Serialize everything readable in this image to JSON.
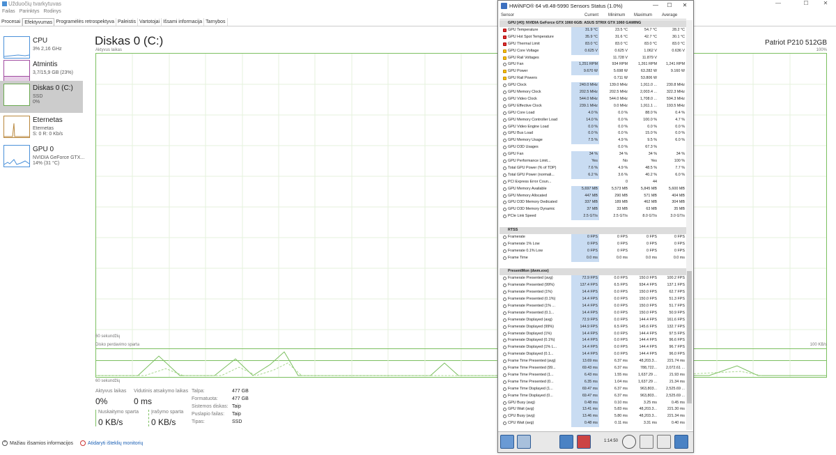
{
  "taskmanager": {
    "title": "Užduočių tvarkytuvas",
    "menu": [
      "Failas",
      "Parinktys",
      "Rodinys"
    ],
    "tabs": [
      "Procesai",
      "Efektyvumas",
      "Programėlės retrospektyva",
      "Paleistis",
      "Vartotojai",
      "Išsami informacija",
      "Tarnybos"
    ],
    "sidebar": [
      {
        "name": "CPU",
        "sub1": "3% 2,16 GHz",
        "sub2": ""
      },
      {
        "name": "Atmintis",
        "sub1": "3,7/15,9 GB (23%)",
        "sub2": ""
      },
      {
        "name": "Diskas 0 (C:)",
        "sub1": "SSD",
        "sub2": "0%"
      },
      {
        "name": "Eternetas",
        "sub1": "Eternetas",
        "sub2": "S: 0 R: 0 Kb/s"
      },
      {
        "name": "GPU 0",
        "sub1": "NVIDIA GeForce GTX...",
        "sub2": "14% (31 °C)"
      }
    ],
    "main": {
      "title": "Diskas 0 (C:)",
      "device": "Patriot P210 512GB",
      "active_label": "Aktyvus laikas",
      "active_max": "100%",
      "seconds_label": "60 sekundžių",
      "speed_label": "Disko perdavimo sparta",
      "speed_max": "100 KB/s",
      "seconds_label2": "60 sekundžių"
    },
    "stats": {
      "active_time_label": "Aktyvus laikas",
      "active_time": "0%",
      "avg_response_label": "Vidutinis atsakymo laikas",
      "avg_response": "0 ms",
      "read_label": "Nuskaitymo sparta",
      "read": "0 KB/s",
      "write_label": "Įrašymo sparta",
      "write": "0 KB/s",
      "info": [
        {
          "label": "Talpa:",
          "value": "477 GB"
        },
        {
          "label": "Formatuota:",
          "value": "477 GB"
        },
        {
          "label": "Sistemos diskas:",
          "value": "Taip"
        },
        {
          "label": "Puslapio failas:",
          "value": "Taip"
        },
        {
          "label": "Tipas:",
          "value": "SSD"
        }
      ]
    },
    "footer": {
      "less_details": "Mažiau išsamios informacijos",
      "open_monitor": "Atidaryti išteklių monitorių"
    }
  },
  "hwinfo": {
    "title": "HWiNFO® 64 v8.48-5990 Sensors Status (1.0%)",
    "columns": {
      "sensor": "Sensor",
      "current": "Current",
      "min": "Minimum",
      "max": "Maximum",
      "avg": "Average"
    },
    "time": "1:14:50",
    "rows": [
      {
        "type": "group",
        "name": "GPU [#0]: NVIDIA GeForce GTX 1060 6GB: ASUS STRIX GTX 1060 GAMING"
      },
      {
        "icon": "red",
        "name": "GPU Temperature",
        "cur": "31.9 °C",
        "min": "23.5 °C",
        "max": "54.7 °C",
        "avg": "28.2 °C"
      },
      {
        "icon": "red",
        "name": "GPU Hot Spot Temperature",
        "cur": "35.9 °C",
        "min": "31.6 °C",
        "max": "42.7 °C",
        "avg": "30.1 °C"
      },
      {
        "icon": "red",
        "name": "GPU Thermal Limit",
        "cur": "83.0 °C",
        "min": "83.0 °C",
        "max": "83.0 °C",
        "avg": "83.0 °C"
      },
      {
        "icon": "yel",
        "name": "GPU Core Voltage",
        "cur": "0.625 V",
        "min": "0.625 V",
        "max": "1.062 V",
        "avg": "0.636 V"
      },
      {
        "icon": "yel",
        "name": "GPU Rail Voltages",
        "cur": "",
        "min": "11.728 V",
        "max": "11.879 V",
        "avg": ""
      },
      {
        "icon": "fan",
        "name": "GPU Fan",
        "cur": "1,251 RPM",
        "min": "934 RPM",
        "max": "1,261 RPM",
        "avg": "1,241 RPM"
      },
      {
        "icon": "yel",
        "name": "GPU Power",
        "cur": "9.670 W",
        "min": "5.698 W",
        "max": "63.282 W",
        "avg": "9.160 W"
      },
      {
        "icon": "yel",
        "name": "GPU Rail Powers",
        "cur": "",
        "min": "0.711 W",
        "max": "53.806 W",
        "avg": ""
      },
      {
        "icon": "clk",
        "name": "GPU Clock",
        "cur": "240.0 MHz",
        "min": "139.0 MHz",
        "max": "1,911.0 ...",
        "avg": "230.8 MHz"
      },
      {
        "icon": "clk",
        "name": "GPU Memory Clock",
        "cur": "202.5 MHz",
        "min": "202.5 MHz",
        "max": "2,003.4 ...",
        "avg": "322.3 MHz"
      },
      {
        "icon": "clk",
        "name": "GPU Video Clock",
        "cur": "544.0 MHz",
        "min": "544.0 MHz",
        "max": "1,708.0 ...",
        "avg": "594.3 MHz"
      },
      {
        "icon": "clk",
        "name": "GPU Effective Clock",
        "cur": "239.1 MHz",
        "min": "0.0 MHz",
        "max": "1,911.1 ...",
        "avg": "193.5 MHz"
      },
      {
        "icon": "clk",
        "name": "GPU Core Load",
        "cur": "4.0 %",
        "min": "0.0 %",
        "max": "88.0 %",
        "avg": "0.4 %"
      },
      {
        "icon": "clk",
        "name": "GPU Memory Controller Load",
        "cur": "14.0 %",
        "min": "0.0 %",
        "max": "100.0 %",
        "avg": "4.7 %"
      },
      {
        "icon": "clk",
        "name": "GPU Video Engine Load",
        "cur": "0.0 %",
        "min": "0.0 %",
        "max": "0.0 %",
        "avg": "0.0 %"
      },
      {
        "icon": "clk",
        "name": "GPU Bus Load",
        "cur": "0.0 %",
        "min": "0.0 %",
        "max": "15.0 %",
        "avg": "0.0 %"
      },
      {
        "icon": "clk",
        "name": "GPU Memory Usage",
        "cur": "7.5 %",
        "min": "4.9 %",
        "max": "9.5 %",
        "avg": "6.0 %"
      },
      {
        "icon": "clk",
        "name": "GPU D3D Usages",
        "cur": "",
        "min": "0.0 %",
        "max": "67.3 %",
        "avg": ""
      },
      {
        "icon": "clk",
        "name": "GPU Fan",
        "cur": "34 %",
        "min": "34 %",
        "max": "34 %",
        "avg": "34 %"
      },
      {
        "icon": "clk",
        "name": "GPU Performance Limit...",
        "cur": "Yes",
        "min": "No",
        "max": "Yes",
        "avg": "100 %"
      },
      {
        "icon": "clk",
        "name": "Total GPU Power (% of TDP)",
        "cur": "7.6 %",
        "min": "4.9 %",
        "max": "48.5 %",
        "avg": "7.7 %"
      },
      {
        "icon": "clk",
        "name": "Total GPU Power (normali...",
        "cur": "6.2 %",
        "min": "3.6 %",
        "max": "40.2 %",
        "avg": "6.0 %"
      },
      {
        "icon": "clk",
        "name": "PCI Express Error Coun...",
        "cur": "",
        "min": "0",
        "max": "44",
        "avg": ""
      },
      {
        "icon": "clk",
        "name": "GPU Memory Available",
        "cur": "5,697 MB",
        "min": "5,573 MB",
        "max": "5,845 MB",
        "avg": "5,600 MB"
      },
      {
        "icon": "clk",
        "name": "GPU Memory Allocated",
        "cur": "447 MB",
        "min": "290 MB",
        "max": "571 MB",
        "avg": "404 MB"
      },
      {
        "icon": "clk",
        "name": "GPU D3D Memory Dedicated",
        "cur": "337 MB",
        "min": "189 MB",
        "max": "462 MB",
        "avg": "304 MB"
      },
      {
        "icon": "clk",
        "name": "GPU D3D Memory Dynamic",
        "cur": "37 MB",
        "min": "33 MB",
        "max": "63 MB",
        "avg": "35 MB"
      },
      {
        "icon": "clk",
        "name": "PCIe Link Speed",
        "cur": "2.5 GT/s",
        "min": "2.5 GT/s",
        "max": "8.0 GT/s",
        "avg": "3.0 GT/s"
      },
      {
        "type": "spacer"
      },
      {
        "type": "group",
        "name": "RTSS"
      },
      {
        "icon": "clk",
        "name": "Framerate",
        "cur": "0 FPS",
        "min": "0 FPS",
        "max": "0 FPS",
        "avg": "0 FPS"
      },
      {
        "icon": "clk",
        "name": "Framerate 1% Low",
        "cur": "0 FPS",
        "min": "0 FPS",
        "max": "0 FPS",
        "avg": "0 FPS"
      },
      {
        "icon": "clk",
        "name": "Framerate 0.1% Low",
        "cur": "0 FPS",
        "min": "0 FPS",
        "max": "0 FPS",
        "avg": "0 FPS"
      },
      {
        "icon": "clk",
        "name": "Frame Time",
        "cur": "0.0 ms",
        "min": "0.0 ms",
        "max": "0.0 ms",
        "avg": "0.0 ms"
      },
      {
        "type": "spacer"
      },
      {
        "type": "group",
        "name": "PresentMon (dwm.exe)"
      },
      {
        "icon": "clk",
        "name": "Framerate Presented (avg)",
        "cur": "72.9 FPS",
        "min": "0.0 FPS",
        "max": "150.0 FPS",
        "avg": "100.2 FPS"
      },
      {
        "icon": "clk",
        "name": "Framerate Presented (99%)",
        "cur": "137.4 FPS",
        "min": "6.5 FPS",
        "max": "934.4 FPS",
        "avg": "137.1 FPS"
      },
      {
        "icon": "clk",
        "name": "Framerate Presented (1%)",
        "cur": "14.4 FPS",
        "min": "0.0 FPS",
        "max": "150.0 FPS",
        "avg": "62.7 FPS"
      },
      {
        "icon": "clk",
        "name": "Framerate Presented (0.1%)",
        "cur": "14.4 FPS",
        "min": "0.0 FPS",
        "max": "150.0 FPS",
        "avg": "51.3 FPS"
      },
      {
        "icon": "clk",
        "name": "Framerate Presented (1% ...",
        "cur": "14.4 FPS",
        "min": "0.0 FPS",
        "max": "150.0 FPS",
        "avg": "51.7 FPS"
      },
      {
        "icon": "clk",
        "name": "Framerate Presented (0.1...",
        "cur": "14.4 FPS",
        "min": "0.0 FPS",
        "max": "150.0 FPS",
        "avg": "50.9 FPS"
      },
      {
        "icon": "clk",
        "name": "Framerate Displayed (avg)",
        "cur": "72.9 FPS",
        "min": "0.0 FPS",
        "max": "144.4 FPS",
        "avg": "161.6 FPS"
      },
      {
        "icon": "clk",
        "name": "Framerate Displayed (99%)",
        "cur": "144.9 FPS",
        "min": "6.5 FPS",
        "max": "145.6 FPS",
        "avg": "132.7 FPS"
      },
      {
        "icon": "clk",
        "name": "Framerate Displayed (1%)",
        "cur": "14.4 FPS",
        "min": "0.0 FPS",
        "max": "144.4 FPS",
        "avg": "97.5 FPS"
      },
      {
        "icon": "clk",
        "name": "Framerate Displayed (0.1%)",
        "cur": "14.4 FPS",
        "min": "0.0 FPS",
        "max": "144.4 FPS",
        "avg": "96.6 FPS"
      },
      {
        "icon": "clk",
        "name": "Framerate Displayed (1% L...",
        "cur": "14.4 FPS",
        "min": "0.0 FPS",
        "max": "144.4 FPS",
        "avg": "96.7 FPS"
      },
      {
        "icon": "clk",
        "name": "Framerate Displayed (0.1...",
        "cur": "14.4 FPS",
        "min": "0.0 FPS",
        "max": "144.4 FPS",
        "avg": "96.0 FPS"
      },
      {
        "icon": "clk",
        "name": "Frame Time Presented (avg)",
        "cur": "13.69 ms",
        "min": "6.37 ms",
        "max": "48,203.3...",
        "avg": "221.74 ms"
      },
      {
        "icon": "clk",
        "name": "Frame Time Presented (99...",
        "cur": "69.43 ms",
        "min": "6.37 ms",
        "max": "788,722...",
        "avg": "2,072.61 ..."
      },
      {
        "icon": "clk",
        "name": "Frame Time Presented (1...",
        "cur": "6.43 ms",
        "min": "1.55 ms",
        "max": "1,637.29 ...",
        "avg": "21.93 ms"
      },
      {
        "icon": "clk",
        "name": "Frame Time Presented (0...",
        "cur": "6.35 ms",
        "min": "1.04 ms",
        "max": "1,637.29 ...",
        "avg": "21.34 ms"
      },
      {
        "icon": "clk",
        "name": "Frame Time Displayed (1...",
        "cur": "69.47 ms",
        "min": "6.37 ms",
        "max": "963,803...",
        "avg": "2,525.69 ..."
      },
      {
        "icon": "clk",
        "name": "Frame Time Displayed (0...",
        "cur": "69.47 ms",
        "min": "6.37 ms",
        "max": "963,803...",
        "avg": "2,525.69 ..."
      },
      {
        "icon": "clk",
        "name": "GPU Busy (avg)",
        "cur": "0.48 ms",
        "min": "0.10 ms",
        "max": "3.25 ms",
        "avg": "0.45 ms"
      },
      {
        "icon": "clk",
        "name": "GPU Wait (avg)",
        "cur": "13.41 ms",
        "min": "5.83 ms",
        "max": "48,203.3...",
        "avg": "221.30 ms"
      },
      {
        "icon": "clk",
        "name": "CPU Busy (avg)",
        "cur": "13.46 ms",
        "min": "5.80 ms",
        "max": "48,203.3...",
        "avg": "221.34 ms"
      },
      {
        "icon": "clk",
        "name": "CPU Wait (avg)",
        "cur": "0.48 ms",
        "min": "0.11 ms",
        "max": "3.31 ms",
        "avg": "0.40 ms"
      }
    ]
  }
}
